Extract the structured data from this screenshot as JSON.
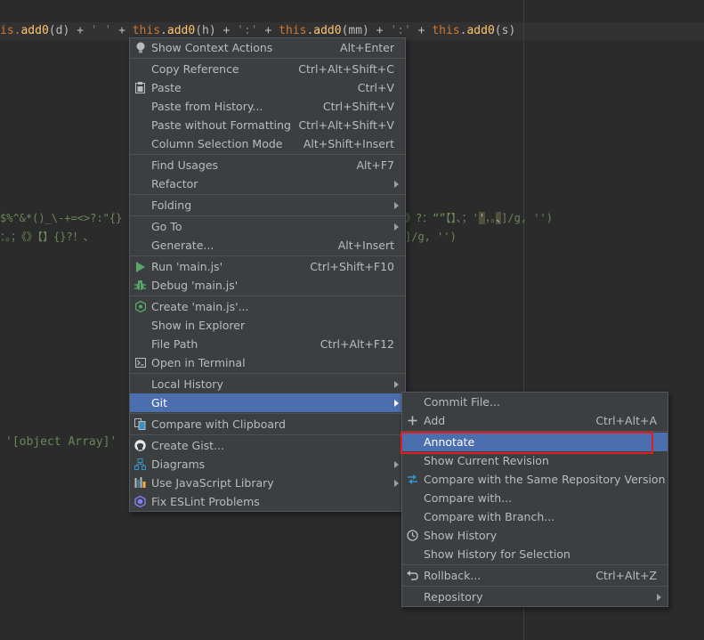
{
  "editor": {
    "line1": {
      "a": "is.",
      "b": "add0",
      "c": "(d) + ",
      "d": "' '",
      "e": " + ",
      "f": "this",
      "g": ".",
      "h": "add0",
      "i": "(h) + ",
      "j": "':'",
      "k": " + ",
      "l": "this",
      "m": ".",
      "n": "add0",
      "o": "(mm) + ",
      "p": "':'",
      "q": " + ",
      "r": "this",
      "s": ".",
      "t": "add0",
      "u": "(s)"
    },
    "line2": {
      "a": "$%^&*()_\\-+=<>?:\"{}",
      "b": "》?：“”【】、；'",
      "c": "'",
      "d": "，。",
      "e": "、",
      "f": "]/g, '')"
    },
    "line3": {
      "a": "：。；《》【】{}?！、",
      "b": "]/g, '')"
    },
    "line4": "'[object Array]'"
  },
  "context_menu": {
    "items": [
      {
        "label": "Show Context Actions",
        "shortcut": "Alt+Enter",
        "icon": "lightbulb-icon"
      },
      {
        "label": "Copy Reference",
        "shortcut": "Ctrl+Alt+Shift+C"
      },
      {
        "label": "Paste",
        "shortcut": "Ctrl+V",
        "icon": "clipboard-icon"
      },
      {
        "label": "Paste from History...",
        "shortcut": "Ctrl+Shift+V"
      },
      {
        "label": "Paste without Formatting",
        "shortcut": "Ctrl+Alt+Shift+V"
      },
      {
        "label": "Column Selection Mode",
        "shortcut": "Alt+Shift+Insert"
      },
      {
        "label": "Find Usages",
        "shortcut": "Alt+F7"
      },
      {
        "label": "Refactor",
        "submenu": true
      },
      {
        "label": "Folding",
        "submenu": true
      },
      {
        "label": "Go To",
        "submenu": true
      },
      {
        "label": "Generate...",
        "shortcut": "Alt+Insert"
      },
      {
        "label": "Run 'main.js'",
        "shortcut": "Ctrl+Shift+F10",
        "icon": "run-icon"
      },
      {
        "label": "Debug 'main.js'",
        "icon": "debug-icon"
      },
      {
        "label": "Create 'main.js'...",
        "icon": "nodejs-icon"
      },
      {
        "label": "Show in Explorer"
      },
      {
        "label": "File Path",
        "shortcut": "Ctrl+Alt+F12"
      },
      {
        "label": "Open in Terminal",
        "icon": "terminal-icon"
      },
      {
        "label": "Local History",
        "submenu": true
      },
      {
        "label": "Git",
        "submenu": true,
        "selected": true
      },
      {
        "label": "Compare with Clipboard",
        "icon": "compare-icon"
      },
      {
        "label": "Create Gist...",
        "icon": "github-icon"
      },
      {
        "label": "Diagrams",
        "submenu": true,
        "icon": "diagram-icon"
      },
      {
        "label": "Use JavaScript Library",
        "submenu": true,
        "icon": "library-icon"
      },
      {
        "label": "Fix ESLint Problems",
        "icon": "eslint-icon"
      }
    ]
  },
  "git_submenu": {
    "items": [
      {
        "label": "Commit File..."
      },
      {
        "label": "Add",
        "shortcut": "Ctrl+Alt+A",
        "icon": "plus-icon"
      },
      {
        "label": "Annotate",
        "selected": true
      },
      {
        "label": "Show Current Revision"
      },
      {
        "label": "Compare with the Same Repository Version",
        "icon": "compare-arrows-icon"
      },
      {
        "label": "Compare with..."
      },
      {
        "label": "Compare with Branch..."
      },
      {
        "label": "Show History",
        "icon": "history-icon"
      },
      {
        "label": "Show History for Selection"
      },
      {
        "label": "Rollback...",
        "shortcut": "Ctrl+Alt+Z",
        "icon": "rollback-icon"
      },
      {
        "label": "Repository",
        "submenu": true
      }
    ]
  },
  "colors": {
    "editor_bg": "#2b2b2b",
    "menu_bg": "#3c3f41",
    "selection": "#4b6eaf",
    "highlight_box": "#e01e1e"
  }
}
